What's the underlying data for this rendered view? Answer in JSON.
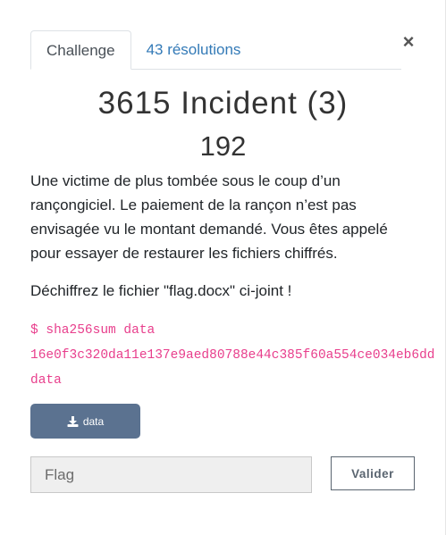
{
  "tabs": [
    {
      "label": "Challenge"
    },
    {
      "label": "43 résolutions"
    }
  ],
  "close_label": "×",
  "challenge": {
    "name": "3615 Incident (3)",
    "points": "192",
    "description": "Une victime de plus tombée sous le coup d’un rançongiciel. Le paiement de la rançon n’est pas envisagée vu le montant demandé. Vous êtes appelé pour essayer de restaurer les fichiers chiffrés.",
    "instruction": "Déchiffrez le fichier \"flag.docx\" ci-joint !",
    "code_lines": [
      "$ sha256sum data",
      "16e0f3c320da11e137e9aed80788e44c385f60a554ce034eb6dd",
      "data"
    ]
  },
  "download": {
    "label": "data",
    "icon": "download-icon"
  },
  "flag_input": {
    "value": "",
    "placeholder": "Flag"
  },
  "submit_label": "Valider",
  "colors": {
    "link": "#337ab7",
    "code": "#e83e8c",
    "download_bg": "#5b7290"
  }
}
